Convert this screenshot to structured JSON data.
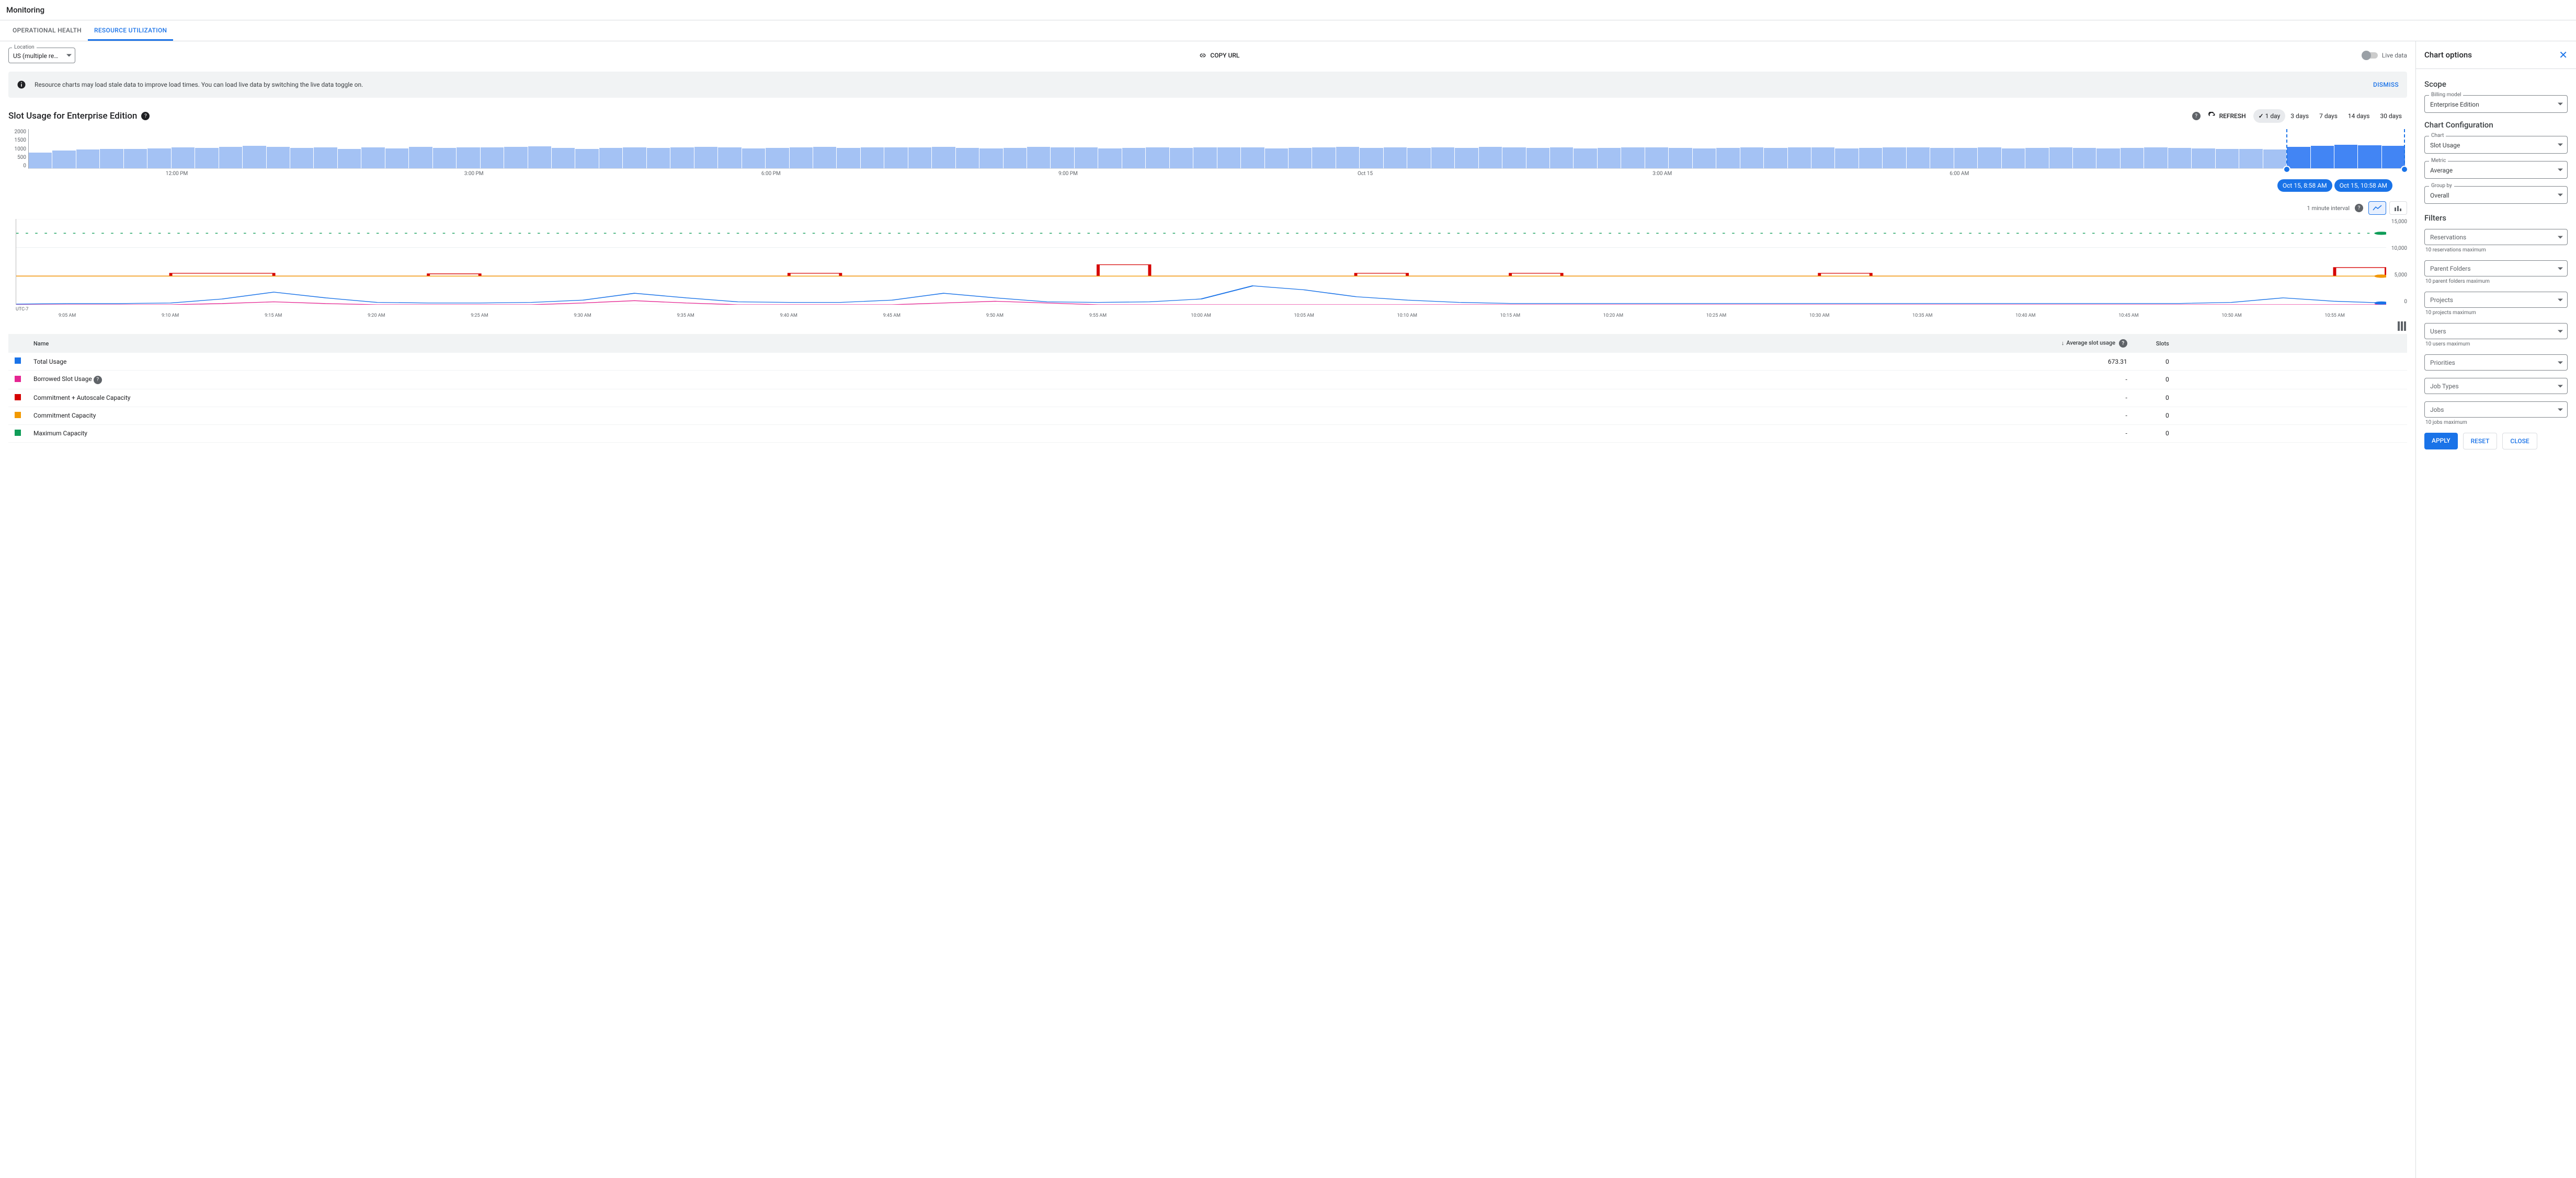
{
  "title": "Monitoring",
  "tabs": {
    "op": "OPERATIONAL HEALTH",
    "ru": "RESOURCE UTILIZATION"
  },
  "location": {
    "label": "Location",
    "value": "US (multiple regions in Un..."
  },
  "copy_url": "COPY URL",
  "live_data": "Live data",
  "banner": {
    "msg": "Resource charts may load stale data to improve load times. You can load live data by switching the live data toggle on.",
    "dismiss": "DISMISS"
  },
  "chart": {
    "title": "Slot Usage for Enterprise Edition",
    "refresh": "REFRESH",
    "ranges": [
      "1 day",
      "3 days",
      "7 days",
      "14 days",
      "30 days"
    ],
    "interval": "1 minute interval"
  },
  "chart_data": {
    "overview": {
      "type": "bar",
      "ylabel": "",
      "ylim": [
        0,
        2000
      ],
      "yticks": [
        0,
        500,
        1000,
        1500,
        2000
      ],
      "xlabels": [
        "12:00 PM",
        "3:00 PM",
        "6:00 PM",
        "9:00 PM",
        "Oct 15",
        "3:00 AM",
        "6:00 AM",
        ""
      ],
      "selection": {
        "from": "Oct 15, 8:58 AM",
        "to": "Oct 15, 10:58 AM"
      },
      "values": [
        800,
        900,
        950,
        1000,
        980,
        1020,
        1060,
        1040,
        1100,
        1150,
        1100,
        1050,
        1080,
        1000,
        1060,
        1020,
        1100,
        1050,
        1080,
        1060,
        1100,
        1120,
        1050,
        1000,
        1040,
        1080,
        1050,
        1070,
        1100,
        1060,
        1020,
        1040,
        1080,
        1100,
        1050,
        1070,
        1060,
        1080,
        1100,
        1040,
        1020,
        1050,
        1100,
        1060,
        1080,
        1020,
        1040,
        1080,
        1050,
        1070,
        1060,
        1080,
        1020,
        1040,
        1070,
        1100,
        1050,
        1060,
        1040,
        1080,
        1050,
        1100,
        1060,
        1040,
        1080,
        1020,
        1050,
        1060,
        1080,
        1040,
        1020,
        1050,
        1060,
        1040,
        1080,
        1060,
        1020,
        1040,
        1060,
        1080,
        1040,
        1050,
        1060,
        1020,
        1040,
        1080,
        1050,
        1020,
        1040,
        1060,
        1050,
        1020,
        1000,
        980,
        950,
        1100,
        1150,
        1200,
        1180,
        1150
      ]
    },
    "detail": {
      "type": "line",
      "ylim": [
        0,
        15000
      ],
      "yticks": [
        0,
        5000,
        10000,
        15000
      ],
      "tz": "UTC-7",
      "xlabels": [
        "9:05 AM",
        "9:10 AM",
        "9:15 AM",
        "9:20 AM",
        "9:25 AM",
        "9:30 AM",
        "9:35 AM",
        "9:40 AM",
        "9:45 AM",
        "9:50 AM",
        "9:55 AM",
        "10:00 AM",
        "10:05 AM",
        "10:10 AM",
        "10:15 AM",
        "10:20 AM",
        "10:25 AM",
        "10:30 AM",
        "10:35 AM",
        "10:40 AM",
        "10:45 AM",
        "10:50 AM",
        "10:55 AM"
      ],
      "series": [
        {
          "name": "Maximum Capacity",
          "color": "#0f9d58",
          "style": "dotted",
          "flat": 12500
        },
        {
          "name": "Commitment + Autoscale Capacity",
          "color": "#d50000",
          "style": "step",
          "values": [
            5000,
            5000,
            5000,
            5500,
            5500,
            5000,
            5000,
            5000,
            5400,
            5000,
            5000,
            5000,
            5000,
            5000,
            5000,
            5500,
            5000,
            5000,
            5000,
            5000,
            5000,
            7000,
            5000,
            5000,
            5000,
            5000,
            5500,
            5000,
            5000,
            5500,
            5000,
            5000,
            5000,
            5000,
            5000,
            5500,
            5000,
            5000,
            5000,
            5000,
            5000,
            5000,
            5000,
            5000,
            5000,
            6500,
            5000
          ]
        },
        {
          "name": "Commitment Capacity",
          "color": "#f29900",
          "style": "solid",
          "flat": 5000
        },
        {
          "name": "Borrowed Slot Usage",
          "color": "#e52592",
          "style": "solid",
          "values": [
            0,
            0,
            0,
            0,
            200,
            500,
            200,
            0,
            0,
            0,
            0,
            300,
            700,
            300,
            0,
            0,
            0,
            0,
            300,
            600,
            300,
            0,
            0,
            0,
            0,
            0,
            0,
            0,
            0,
            0,
            0,
            0,
            0,
            0,
            0,
            0,
            0,
            0,
            0,
            0,
            0,
            0,
            0,
            0,
            0,
            0,
            0
          ]
        },
        {
          "name": "Total Usage",
          "color": "#1a73e8",
          "style": "solid",
          "values": [
            100,
            200,
            200,
            300,
            1000,
            2200,
            1200,
            400,
            300,
            300,
            400,
            800,
            2000,
            1200,
            500,
            400,
            400,
            800,
            2000,
            1200,
            500,
            400,
            500,
            1000,
            3300,
            2600,
            1400,
            800,
            400,
            220,
            220,
            220,
            220,
            220,
            220,
            220,
            220,
            220,
            220,
            220,
            220,
            220,
            220,
            400,
            1200,
            600,
            300
          ]
        }
      ]
    }
  },
  "table": {
    "cols": {
      "name": "Name",
      "avg": "Average slot usage",
      "slots": "Slots"
    },
    "rows": [
      {
        "swatch": "#1a73e8",
        "name": "Total Usage",
        "avg": "673.31",
        "slots": "0",
        "help": false
      },
      {
        "swatch": "#e52592",
        "name": "Borrowed Slot Usage",
        "avg": "-",
        "slots": "0",
        "help": true
      },
      {
        "swatch": "#d50000",
        "name": "Commitment + Autoscale Capacity",
        "avg": "-",
        "slots": "0",
        "help": false
      },
      {
        "swatch": "#f29900",
        "name": "Commitment Capacity",
        "avg": "-",
        "slots": "0",
        "help": false
      },
      {
        "swatch": "#0f9d58",
        "name": "Maximum Capacity",
        "avg": "-",
        "slots": "0",
        "help": false
      }
    ]
  },
  "side": {
    "title": "Chart options",
    "scope": {
      "title": "Scope",
      "billing_label": "Billing model",
      "billing_val": "Enterprise Edition"
    },
    "config": {
      "title": "Chart Configuration",
      "chart_label": "Chart",
      "chart_val": "Slot Usage",
      "metric_label": "Metric",
      "metric_val": "Average",
      "group_label": "Group by",
      "group_val": "Overall"
    },
    "filters": {
      "title": "Filters",
      "reservations": {
        "ph": "Reservations",
        "hint": "10 reservations maximum"
      },
      "folders": {
        "ph": "Parent Folders",
        "hint": "10 parent folders maximum"
      },
      "projects": {
        "ph": "Projects",
        "hint": "10 projects maximum"
      },
      "users": {
        "ph": "Users",
        "hint": "10 users maximum"
      },
      "priorities": {
        "ph": "Priorities"
      },
      "jobtypes": {
        "ph": "Job Types"
      },
      "jobs": {
        "ph": "Jobs",
        "hint": "10 jobs maximum"
      }
    },
    "btns": {
      "apply": "APPLY",
      "reset": "RESET",
      "close": "CLOSE"
    }
  }
}
